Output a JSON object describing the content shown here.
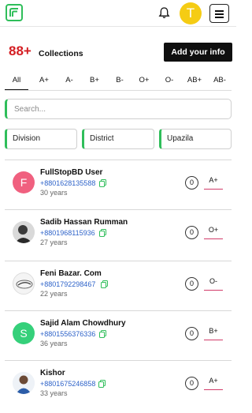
{
  "header": {
    "avatar_initial": "T"
  },
  "summary": {
    "count": "88+",
    "label": "Collections",
    "add_button": "Add your info"
  },
  "tabs": [
    {
      "label": "All",
      "active": true
    },
    {
      "label": "A+"
    },
    {
      "label": "A-"
    },
    {
      "label": "B+"
    },
    {
      "label": "B-"
    },
    {
      "label": "O+"
    },
    {
      "label": "O-"
    },
    {
      "label": "AB+"
    },
    {
      "label": "AB-"
    }
  ],
  "search": {
    "placeholder": "Search..."
  },
  "filters": {
    "division": "Division",
    "district": "District",
    "upazila": "Upazila"
  },
  "donors": [
    {
      "name": "FullStopBD User",
      "phone": "+8801628135588",
      "age": "30 years",
      "count": "0",
      "blood_group": "A+",
      "avatar": "F",
      "avatar_color": "#f0607f"
    },
    {
      "name": "Sadib Hassan Rumman",
      "phone": "+8801968115936",
      "age": "27 years",
      "count": "0",
      "blood_group": "O+",
      "avatar": "",
      "avatar_color": "#555555"
    },
    {
      "name": "Feni Bazar. Com",
      "phone": "+8801792298467",
      "age": "22 years",
      "count": "0",
      "blood_group": "O-",
      "avatar": "",
      "avatar_color": "#f4f4f4"
    },
    {
      "name": "Sajid Alam Chowdhury",
      "phone": "+8801556376336",
      "age": "36 years",
      "count": "0",
      "blood_group": "B+",
      "avatar": "S",
      "avatar_color": "#35d07a"
    },
    {
      "name": "Kishor",
      "phone": "+8801675246858",
      "age": "33 years",
      "count": "0",
      "blood_group": "A+",
      "avatar": "",
      "avatar_color": "#e9eef5"
    }
  ],
  "colors": {
    "accent_green": "#2fbe5a",
    "count_red": "#d41d22",
    "phone_blue": "#2e63c9",
    "blood_underline": "#d23c6a"
  }
}
